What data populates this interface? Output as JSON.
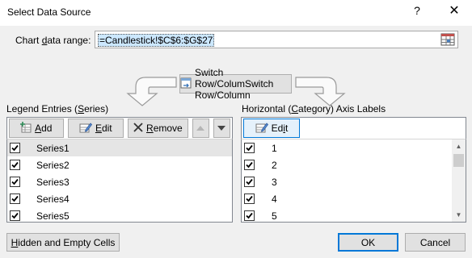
{
  "dialog": {
    "title": "Select Data Source",
    "help_glyph": "?",
    "close_glyph": "✕"
  },
  "data_range": {
    "label_pre": "Chart ",
    "label_accel": "d",
    "label_post": "ata range:",
    "value": "=Candlestick!$C$6:$G$27",
    "picker_icon": "range-picker-icon"
  },
  "switch": {
    "accel": "W",
    "label_post": "Switch Row/Column",
    "icon": "switch-row-column-icon"
  },
  "legend": {
    "label_pre": "Legend Entries (",
    "label_accel": "S",
    "label_post": "eries)",
    "add_accel": "A",
    "add_rest": "dd",
    "edit_accel": "E",
    "edit_rest": "dit",
    "remove_accel": "R",
    "remove_rest": "emove",
    "items": [
      {
        "label": "Series1",
        "checked": true,
        "selected": true
      },
      {
        "label": "Series2",
        "checked": true,
        "selected": false
      },
      {
        "label": "Series3",
        "checked": true,
        "selected": false
      },
      {
        "label": "Series4",
        "checked": true,
        "selected": false
      },
      {
        "label": "Series5",
        "checked": true,
        "selected": false
      }
    ]
  },
  "axis": {
    "label_pre": "Horizontal (",
    "label_accel": "C",
    "label_post": "ategory) Axis Labels",
    "edit_pre": "Ed",
    "edit_accel": "i",
    "edit_post": "t",
    "items": [
      {
        "label": "1",
        "checked": true
      },
      {
        "label": "2",
        "checked": true
      },
      {
        "label": "3",
        "checked": true
      },
      {
        "label": "4",
        "checked": true
      },
      {
        "label": "5",
        "checked": true
      }
    ]
  },
  "footer": {
    "hidden_accel": "H",
    "hidden_rest": "idden and Empty Cells",
    "ok_label": "OK",
    "cancel_label": "Cancel"
  },
  "colors": {
    "selection": "#cce8ff",
    "default_button_border": "#0078d7",
    "remove_icon": "#333333"
  }
}
